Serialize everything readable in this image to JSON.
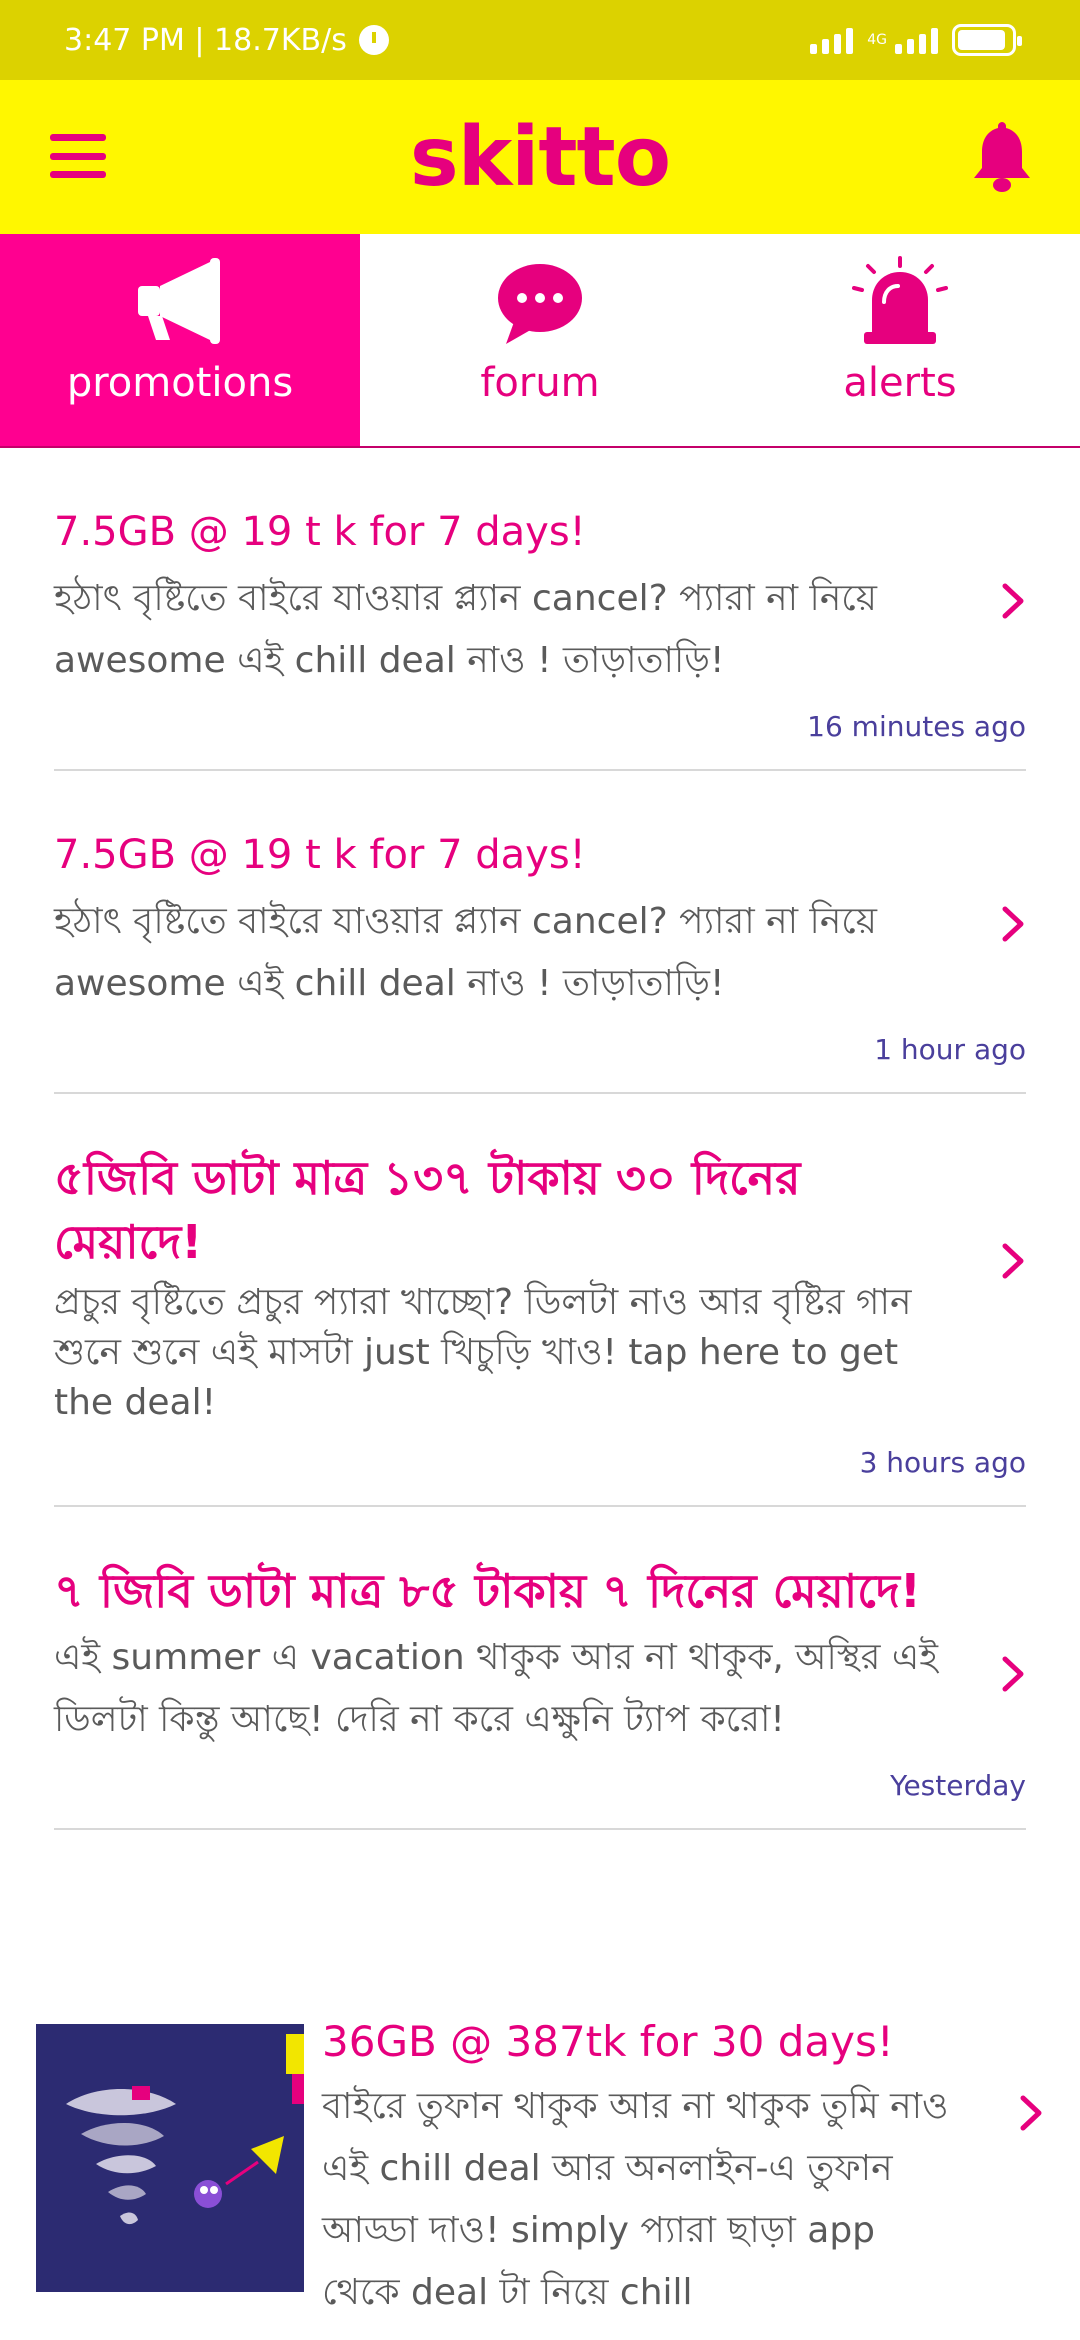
{
  "status_bar": {
    "time_speed": "3:47 PM | 18.7KB/s",
    "network": "4G"
  },
  "app_bar": {
    "logo": "skitto"
  },
  "tabs": [
    {
      "label": "promotions",
      "icon": "megaphone-icon",
      "active": true
    },
    {
      "label": "forum",
      "icon": "chat-bubble-icon",
      "active": false
    },
    {
      "label": "alerts",
      "icon": "siren-icon",
      "active": false
    }
  ],
  "feed": [
    {
      "title": "7.5GB @ 19 t k for 7  days!",
      "body": "হঠাৎ বৃষ্টিতে বাইরে যাওয়ার প্ল্যান cancel? প্যারা না নিয়ে awesome এই chill deal নাও ! তাড়াতাড়ি!",
      "time": "16 minutes ago"
    },
    {
      "title": "7.5GB @ 19 t k for 7  days!",
      "body": "হঠাৎ বৃষ্টিতে বাইরে যাওয়ার প্ল্যান cancel? প্যারা না নিয়ে awesome এই chill deal নাও ! তাড়াতাড়ি!",
      "time": "1 hour ago"
    },
    {
      "title": "৫জিবি ডাটা মাত্র ১৩৭ টাকায় ৩০ দিনের মেয়াদে!",
      "body": "প্রচুর বৃষ্টিতে প্রচুর প্যারা খাচ্ছো? ডিলটা নাও আর বৃষ্টির গান শুনে শুনে এই মাসটা just খিচুড়ি খাও! tap here to get the deal!",
      "time": "3 hours ago"
    },
    {
      "title": "৭ জিবি ডাটা মাত্র ৮৫ টাকায় ৭ দিনের মেয়াদে!",
      "body": "এই summer এ vacation থাকুক আর না থাকুক, অস্থির এই ডিলটা কিন্তু আছে! দেরি না করে এক্ষুনি ট্যাপ করো!",
      "time": "Yesterday"
    }
  ],
  "feed_image_item": {
    "title": "36GB @ 387tk for 30 days!",
    "body": "বাইরে তুফান থাকুক আর না থাকুক তুমি নাও এই chill deal আর অনলাইন-এ তুফান আড্ডা দাও! simply প্যারা ছাড়া app থেকে deal টা নিয়ে chill"
  },
  "colors": {
    "status_bar": "#dcd200",
    "app_bar": "#fff700",
    "brand": "#e6007e",
    "active_tab": "#ff0090",
    "timestamp": "#4a3f9c"
  }
}
